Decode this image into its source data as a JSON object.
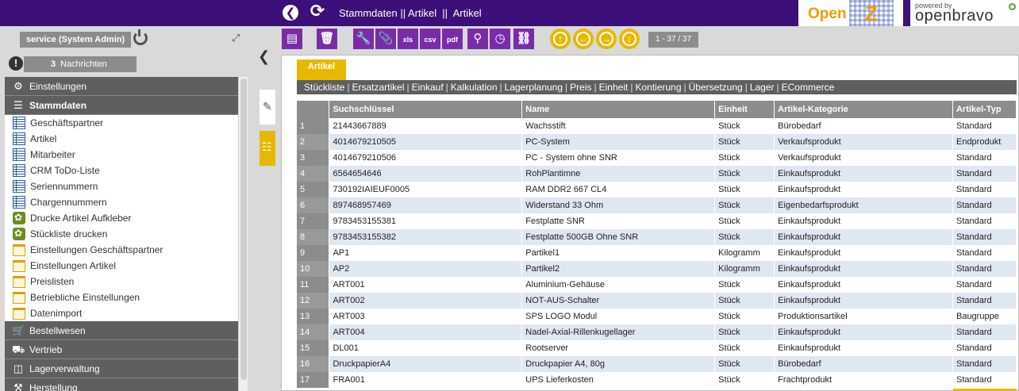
{
  "header": {
    "breadcrumb": "Stammdaten || Artikel  ||  Artikel",
    "logo_openz": "Open",
    "logo_openz_z": "Z",
    "logo_ob_powered": "powered by",
    "logo_ob_name": "openbravo"
  },
  "sidebar": {
    "user": "service (System Admin)",
    "messages_count": "3",
    "messages_label": "Nachrichten",
    "sections": {
      "einstellungen": "Einstellungen",
      "stammdaten": "Stammdaten",
      "bestellwesen": "Bestellwesen",
      "vertrieb": "Vertrieb",
      "lagerverwaltung": "Lagerverwaltung",
      "herstellung": "Herstellung"
    },
    "items": [
      {
        "label": "Geschäftspartner",
        "icon": "list-icon"
      },
      {
        "label": "Artikel",
        "icon": "list-icon"
      },
      {
        "label": "Mitarbeiter",
        "icon": "list-icon"
      },
      {
        "label": "CRM ToDo-Liste",
        "icon": "list-icon"
      },
      {
        "label": "Seriennummern",
        "icon": "list-icon"
      },
      {
        "label": "Chargennummern",
        "icon": "list-icon"
      },
      {
        "label": "Drucke Artikel Aufkleber",
        "icon": "gear-icon"
      },
      {
        "label": "Stückliste drucken",
        "icon": "gear-icon"
      },
      {
        "label": "Einstellungen Geschäftspartner",
        "icon": "folder-icon"
      },
      {
        "label": "Einstellungen Artikel",
        "icon": "folder-icon"
      },
      {
        "label": "Preislisten",
        "icon": "folder-icon"
      },
      {
        "label": "Betriebliche Einstellungen",
        "icon": "folder-icon"
      },
      {
        "label": "Datenimport",
        "icon": "folder-icon"
      }
    ]
  },
  "toolbar": {
    "xls": "xls",
    "csv": "csv",
    "pdf": "pdf",
    "record_counter": "1 - 37 / 37"
  },
  "tabs": {
    "main": "Artikel",
    "sub": [
      "Stückliste",
      "Ersatzartikel",
      "Einkauf",
      "Kalkulation",
      "Lagerplanung",
      "Preis",
      "Einheit",
      "Kontierung",
      "Übersetzung",
      "Lager",
      "ECommerce"
    ]
  },
  "table": {
    "headers": [
      "",
      "Suchschlüssel",
      "Name",
      "Einheit",
      "Artikel-Kategorie",
      "Artikel-Typ"
    ],
    "rows": [
      [
        "1",
        "21443667889",
        "Wachsstift",
        "Stück",
        "Bürobedarf",
        "Standard"
      ],
      [
        "2",
        "4014679210505",
        "PC-System",
        "Stück",
        "Verkaufsprodukt",
        "Endprodukt"
      ],
      [
        "3",
        "4014679210506",
        "PC - System ohne SNR",
        "Stück",
        "Verkaufsprodukt",
        "Standard"
      ],
      [
        "4",
        "6564654646",
        "RohPlantimne",
        "Stück",
        "Einkaufsprodukt",
        "Standard"
      ],
      [
        "5",
        "730192IAIEUF0005",
        "RAM DDR2 667 CL4",
        "Stück",
        "Einkaufsprodukt",
        "Standard"
      ],
      [
        "6",
        "897468957469",
        "Widerstand 33 Ohm",
        "Stück",
        "Eigenbedarfsprodukt",
        "Standard"
      ],
      [
        "7",
        "9783453155381",
        "Festplatte SNR",
        "Stück",
        "Einkaufsprodukt",
        "Standard"
      ],
      [
        "8",
        "9783453155382",
        "Festplatte 500GB Ohne SNR",
        "Stück",
        "Einkaufsprodukt",
        "Standard"
      ],
      [
        "9",
        "AP1",
        "Partikel1",
        "Kilogramm",
        "Einkaufsprodukt",
        "Standard"
      ],
      [
        "10",
        "AP2",
        "Partikel2",
        "Kilogramm",
        "Einkaufsprodukt",
        "Standard"
      ],
      [
        "11",
        "ART001",
        "Aluminium-Gehäuse",
        "Stück",
        "Einkaufsprodukt",
        "Standard"
      ],
      [
        "12",
        "ART002",
        "NOT-AUS-Schalter",
        "Stück",
        "Einkaufsprodukt",
        "Standard"
      ],
      [
        "13",
        "ART003",
        "SPS LOGO Modul",
        "Stück",
        "Produktionsartikel",
        "Baugruppe"
      ],
      [
        "14",
        "ART004",
        "Nadel-Axial-Rillenkugellager",
        "Stück",
        "Einkaufsprodukt",
        "Standard"
      ],
      [
        "15",
        "DL001",
        "Rootserver",
        "Stück",
        "Einkaufsprodukt",
        "Standard"
      ],
      [
        "16",
        "DruckpapierA4",
        "Druckpapier A4, 80g",
        "Stück",
        "Bürobedarf",
        "Standard"
      ],
      [
        "17",
        "FRA001",
        "UPS Lieferkosten",
        "Stück",
        "Frachtprodukt",
        "Standard"
      ]
    ]
  },
  "colors": {
    "header_bg": "#3d0f78",
    "toolbar_purple": "#7a2ca8",
    "accent_yellow": "#e8b800",
    "row_alt": "#dfe7f2"
  }
}
